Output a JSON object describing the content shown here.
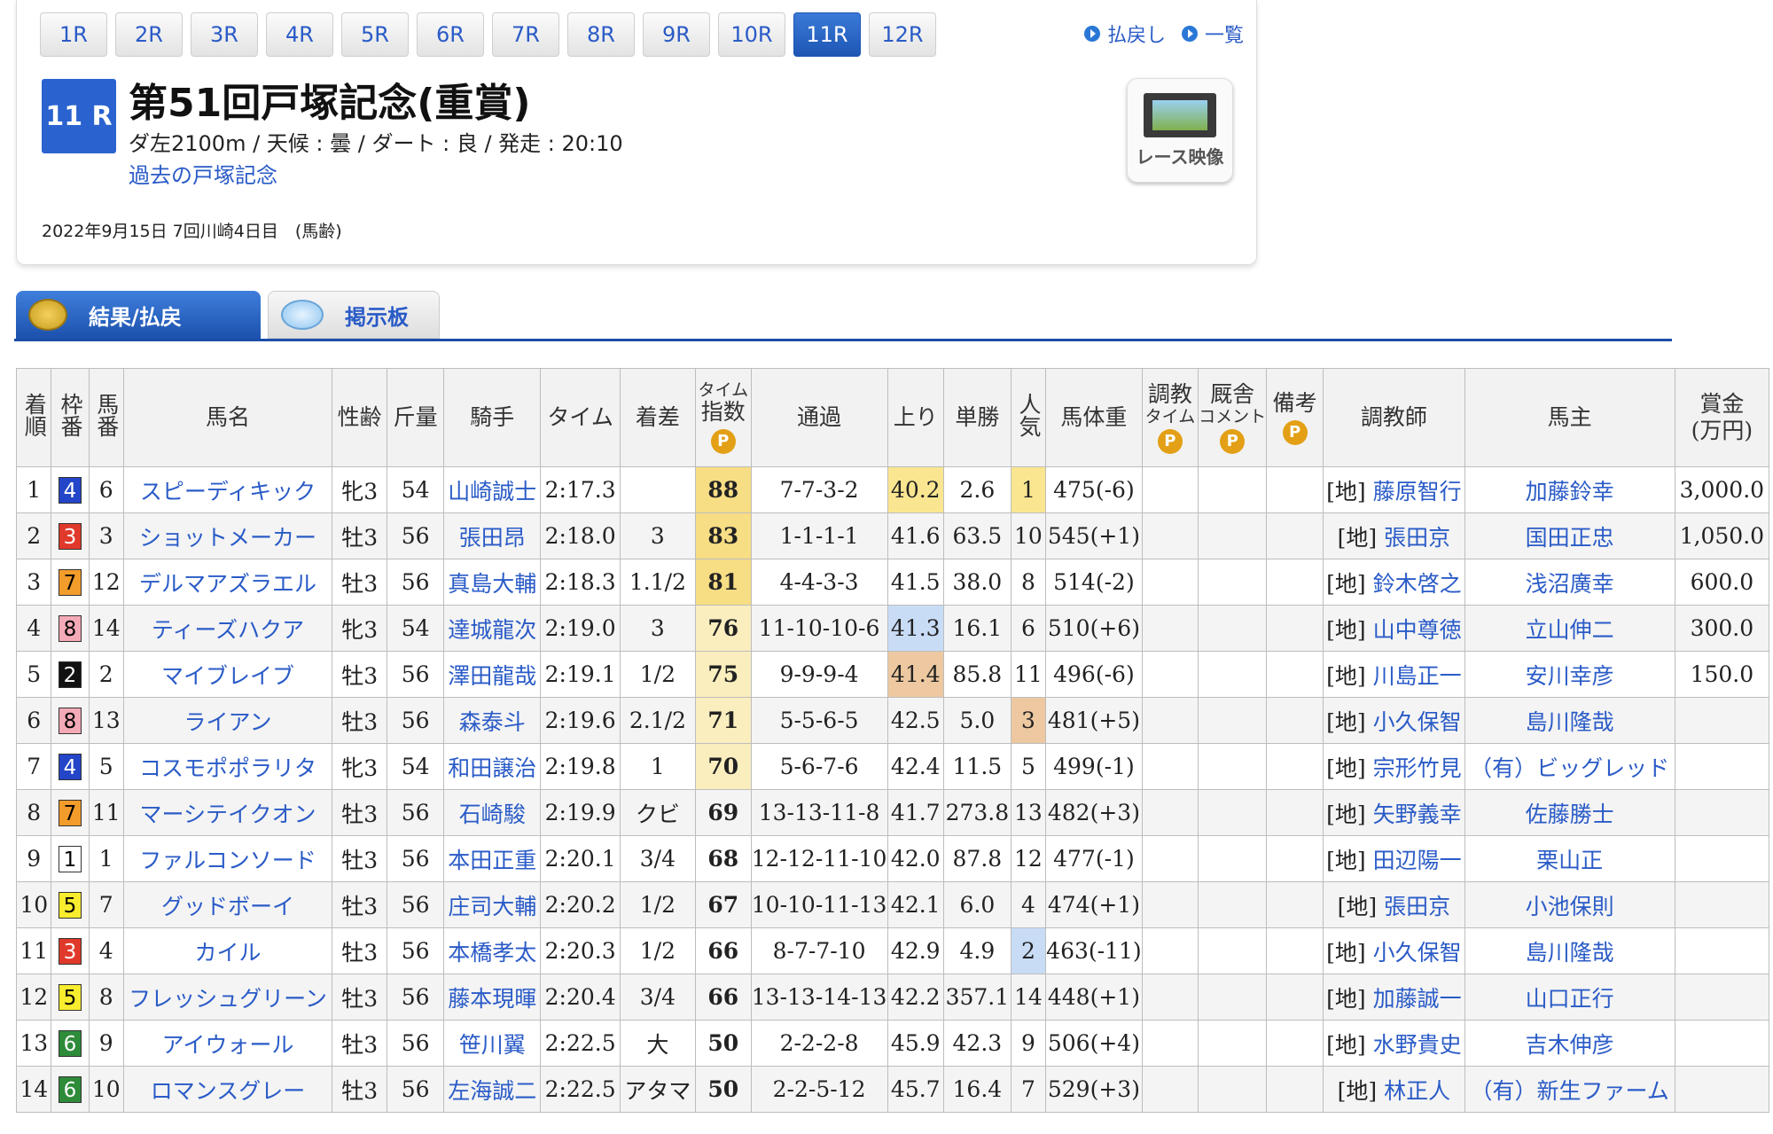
{
  "race_tabs": [
    "1R",
    "2R",
    "3R",
    "4R",
    "5R",
    "6R",
    "7R",
    "8R",
    "9R",
    "10R",
    "11R",
    "12R"
  ],
  "active_tab": "11R",
  "links": {
    "payout": "払戻し",
    "list": "一覧"
  },
  "race": {
    "badge": "11 R",
    "title": "第51回戸塚記念(重賞)",
    "conditions": "ダ左2100m / 天候 : 曇 / ダート : 良 / 発走 : 20:10",
    "past_link": "過去の戸塚記念",
    "date": "2022年9月15日 7回川崎4日目　(馬齢)"
  },
  "video_label": "レース映像",
  "page_tabs": {
    "results": "結果/払戻",
    "board": "掲示板"
  },
  "table": {
    "headers": {
      "rank": "着順",
      "frame": "枠番",
      "num": "馬番",
      "name": "馬名",
      "sexage": "性齢",
      "weight": "斤量",
      "jockey": "騎手",
      "time": "タイム",
      "margin": "着差",
      "index_a": "タイム",
      "index_b": "指数",
      "passing": "通過",
      "last3f": "上り",
      "odds": "単勝",
      "pop": "人気",
      "body": "馬体重",
      "train_a": "調教",
      "train_b": "タイム",
      "comment_a": "厩舎",
      "comment_b": "コメント",
      "note": "備考",
      "trainer": "調教師",
      "owner": "馬主",
      "prize_a": "賞金",
      "prize_b": "(万円)",
      "p_icon": "P"
    },
    "rows": [
      {
        "rank": "1",
        "frame": "4",
        "num": "6",
        "name": "スピーディキック",
        "sexage": "牝3",
        "weight": "54",
        "jockey": "山崎誠士",
        "time": "2:17.3",
        "margin": "",
        "index": "88",
        "passing": "7-7-3-2",
        "last3f": "40.2",
        "odds": "2.6",
        "pop": "1",
        "body": "475(-6)",
        "tag": "[地]",
        "trainer": "藤原智行",
        "owner": "加藤鈴幸",
        "prize": "3,000.0"
      },
      {
        "rank": "2",
        "frame": "3",
        "num": "3",
        "name": "ショットメーカー",
        "sexage": "牡3",
        "weight": "56",
        "jockey": "張田昂",
        "time": "2:18.0",
        "margin": "3",
        "index": "83",
        "passing": "1-1-1-1",
        "last3f": "41.6",
        "odds": "63.5",
        "pop": "10",
        "body": "545(+1)",
        "tag": "[地]",
        "trainer": "張田京",
        "owner": "国田正忠",
        "prize": "1,050.0"
      },
      {
        "rank": "3",
        "frame": "7",
        "num": "12",
        "name": "デルマアズラエル",
        "sexage": "牡3",
        "weight": "56",
        "jockey": "真島大輔",
        "time": "2:18.3",
        "margin": "1.1/2",
        "index": "81",
        "passing": "4-4-3-3",
        "last3f": "41.5",
        "odds": "38.0",
        "pop": "8",
        "body": "514(-2)",
        "tag": "[地]",
        "trainer": "鈴木啓之",
        "owner": "浅沼廣幸",
        "prize": "600.0"
      },
      {
        "rank": "4",
        "frame": "8",
        "num": "14",
        "name": "ティーズハクア",
        "sexage": "牝3",
        "weight": "54",
        "jockey": "達城龍次",
        "time": "2:19.0",
        "margin": "3",
        "index": "76",
        "passing": "11-10-10-6",
        "last3f": "41.3",
        "odds": "16.1",
        "pop": "6",
        "body": "510(+6)",
        "tag": "[地]",
        "trainer": "山中尊徳",
        "owner": "立山伸二",
        "prize": "300.0"
      },
      {
        "rank": "5",
        "frame": "2",
        "num": "2",
        "name": "マイブレイブ",
        "sexage": "牡3",
        "weight": "56",
        "jockey": "澤田龍哉",
        "time": "2:19.1",
        "margin": "1/2",
        "index": "75",
        "passing": "9-9-9-4",
        "last3f": "41.4",
        "odds": "85.8",
        "pop": "11",
        "body": "496(-6)",
        "tag": "[地]",
        "trainer": "川島正一",
        "owner": "安川幸彦",
        "prize": "150.0"
      },
      {
        "rank": "6",
        "frame": "8",
        "num": "13",
        "name": "ライアン",
        "sexage": "牡3",
        "weight": "56",
        "jockey": "森泰斗",
        "time": "2:19.6",
        "margin": "2.1/2",
        "index": "71",
        "passing": "5-5-6-5",
        "last3f": "42.5",
        "odds": "5.0",
        "pop": "3",
        "body": "481(+5)",
        "tag": "[地]",
        "trainer": "小久保智",
        "owner": "島川隆哉",
        "prize": ""
      },
      {
        "rank": "7",
        "frame": "4",
        "num": "5",
        "name": "コスモポポラリタ",
        "sexage": "牝3",
        "weight": "54",
        "jockey": "和田譲治",
        "time": "2:19.8",
        "margin": "1",
        "index": "70",
        "passing": "5-6-7-6",
        "last3f": "42.4",
        "odds": "11.5",
        "pop": "5",
        "body": "499(-1)",
        "tag": "[地]",
        "trainer": "宗形竹見",
        "owner": "（有）ビッグレッド",
        "prize": ""
      },
      {
        "rank": "8",
        "frame": "7",
        "num": "11",
        "name": "マーシテイクオン",
        "sexage": "牡3",
        "weight": "56",
        "jockey": "石崎駿",
        "time": "2:19.9",
        "margin": "クビ",
        "index": "69",
        "passing": "13-13-11-8",
        "last3f": "41.7",
        "odds": "273.8",
        "pop": "13",
        "body": "482(+3)",
        "tag": "[地]",
        "trainer": "矢野義幸",
        "owner": "佐藤勝士",
        "prize": ""
      },
      {
        "rank": "9",
        "frame": "1",
        "num": "1",
        "name": "ファルコンソード",
        "sexage": "牡3",
        "weight": "56",
        "jockey": "本田正重",
        "time": "2:20.1",
        "margin": "3/4",
        "index": "68",
        "passing": "12-12-11-10",
        "last3f": "42.0",
        "odds": "87.8",
        "pop": "12",
        "body": "477(-1)",
        "tag": "[地]",
        "trainer": "田辺陽一",
        "owner": "栗山正",
        "prize": ""
      },
      {
        "rank": "10",
        "frame": "5",
        "num": "7",
        "name": "グッドボーイ",
        "sexage": "牡3",
        "weight": "56",
        "jockey": "庄司大輔",
        "time": "2:20.2",
        "margin": "1/2",
        "index": "67",
        "passing": "10-10-11-13",
        "last3f": "42.1",
        "odds": "6.0",
        "pop": "4",
        "body": "474(+1)",
        "tag": "[地]",
        "trainer": "張田京",
        "owner": "小池保則",
        "prize": ""
      },
      {
        "rank": "11",
        "frame": "3",
        "num": "4",
        "name": "カイル",
        "sexage": "牡3",
        "weight": "56",
        "jockey": "本橋孝太",
        "time": "2:20.3",
        "margin": "1/2",
        "index": "66",
        "passing": "8-7-7-10",
        "last3f": "42.9",
        "odds": "4.9",
        "pop": "2",
        "body": "463(-11)",
        "tag": "[地]",
        "trainer": "小久保智",
        "owner": "島川隆哉",
        "prize": ""
      },
      {
        "rank": "12",
        "frame": "5",
        "num": "8",
        "name": "フレッシュグリーン",
        "sexage": "牡3",
        "weight": "56",
        "jockey": "藤本現暉",
        "time": "2:20.4",
        "margin": "3/4",
        "index": "66",
        "passing": "13-13-14-13",
        "last3f": "42.2",
        "odds": "357.1",
        "pop": "14",
        "body": "448(+1)",
        "tag": "[地]",
        "trainer": "加藤誠一",
        "owner": "山口正行",
        "prize": ""
      },
      {
        "rank": "13",
        "frame": "6",
        "num": "9",
        "name": "アイウォール",
        "sexage": "牡3",
        "weight": "56",
        "jockey": "笹川翼",
        "time": "2:22.5",
        "margin": "大",
        "index": "50",
        "passing": "2-2-2-8",
        "last3f": "45.9",
        "odds": "42.3",
        "pop": "9",
        "body": "506(+4)",
        "tag": "[地]",
        "trainer": "水野貴史",
        "owner": "吉木伸彦",
        "prize": ""
      },
      {
        "rank": "14",
        "frame": "6",
        "num": "10",
        "name": "ロマンスグレー",
        "sexage": "牡3",
        "weight": "56",
        "jockey": "左海誠二",
        "time": "2:22.5",
        "margin": "アタマ",
        "index": "50",
        "passing": "2-2-5-12",
        "last3f": "45.7",
        "odds": "16.4",
        "pop": "7",
        "body": "529(+3)",
        "tag": "[地]",
        "trainer": "林正人",
        "owner": "（有）新生ファーム",
        "prize": ""
      }
    ]
  }
}
